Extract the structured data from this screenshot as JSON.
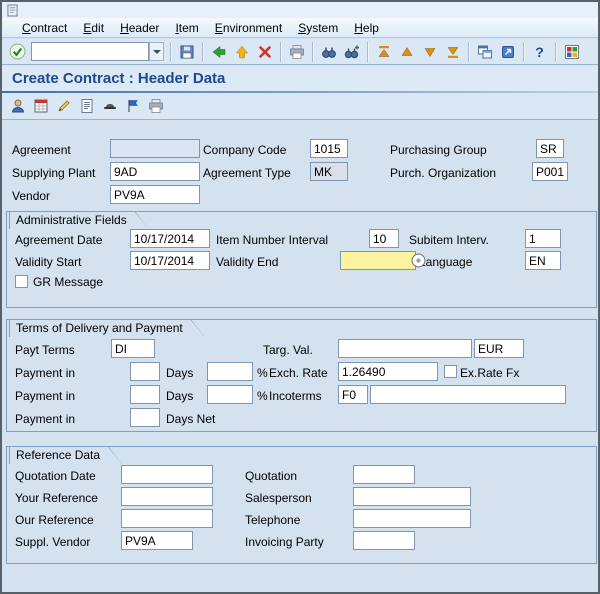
{
  "menu": {
    "items": [
      "Contract",
      "Edit",
      "Header",
      "Item",
      "Environment",
      "System",
      "Help"
    ]
  },
  "toolbar": {
    "command_value": "",
    "icons": [
      "enter",
      "command-field",
      "save",
      "back",
      "exit",
      "cancel",
      "print",
      "find",
      "find-next",
      "first-page",
      "previous-page",
      "next-page",
      "last-page",
      "new-session",
      "create-shortcut",
      "help",
      "customize-layout"
    ]
  },
  "app_toolbar": {
    "icons": [
      "partners",
      "conditions",
      "edit",
      "texts",
      "header-details",
      "flag",
      "print-preview"
    ]
  },
  "title": "Create Contract : Header Data",
  "fields": {
    "agreement": {
      "label": "Agreement",
      "value": ""
    },
    "company_code": {
      "label": "Company Code",
      "value": "1015"
    },
    "purchasing_group": {
      "label": "Purchasing Group",
      "value": "SR"
    },
    "supplying_plant": {
      "label": "Supplying Plant",
      "value": "9AD"
    },
    "agreement_type": {
      "label": "Agreement Type",
      "value": "MK"
    },
    "purch_organization": {
      "label": "Purch. Organization",
      "value": "P001"
    },
    "vendor": {
      "label": "Vendor",
      "value": "PV9A"
    }
  },
  "administrative": {
    "title": "Administrative Fields",
    "agreement_date": {
      "label": "Agreement Date",
      "value": "10/17/2014"
    },
    "item_number_interval": {
      "label": "Item Number Interval",
      "value": "10"
    },
    "subitem_interval": {
      "label": "Subitem Interv.",
      "value": "1"
    },
    "validity_start": {
      "label": "Validity Start",
      "value": "10/17/2014"
    },
    "validity_end": {
      "label": "Validity End",
      "value": ""
    },
    "language": {
      "label": "Language",
      "value": "EN"
    },
    "gr_message": {
      "label": "GR Message",
      "checked": false
    }
  },
  "terms": {
    "title": "Terms of Delivery and Payment",
    "payt_terms": {
      "label": "Payt Terms",
      "value": "DI"
    },
    "targ_val": {
      "label": "Targ. Val.",
      "value": "",
      "currency": "EUR"
    },
    "payment1": {
      "label": "Payment in",
      "days_value": "",
      "days_label": "Days",
      "percent_value": "",
      "percent_label": "%"
    },
    "payment2": {
      "label": "Payment in",
      "days_value": "",
      "days_label": "Days",
      "percent_value": "",
      "percent_label": "%"
    },
    "payment3": {
      "label": "Payment in",
      "days_value": "",
      "days_label": "Days Net"
    },
    "exch_rate": {
      "label": "Exch. Rate",
      "value": "1.26490"
    },
    "ex_rate_fx": {
      "label": "Ex.Rate Fx",
      "checked": false
    },
    "incoterms": {
      "label": "Incoterms",
      "value": "F0",
      "value2": ""
    }
  },
  "reference": {
    "title": "Reference Data",
    "quotation_date": {
      "label": "Quotation Date",
      "value": ""
    },
    "quotation": {
      "label": "Quotation",
      "value": ""
    },
    "your_reference": {
      "label": "Your Reference",
      "value": ""
    },
    "salesperson": {
      "label": "Salesperson",
      "value": ""
    },
    "our_reference": {
      "label": "Our Reference",
      "value": ""
    },
    "telephone": {
      "label": "Telephone",
      "value": ""
    },
    "suppl_vendor": {
      "label": "Suppl. Vendor",
      "value": "PV9A"
    },
    "invoicing_party": {
      "label": "Invoicing Party",
      "value": ""
    }
  },
  "colors": {
    "accent_blue": "#1d4a8f",
    "focus_yellow": "#faf3a0",
    "tray_border": "#7f9fc4"
  }
}
